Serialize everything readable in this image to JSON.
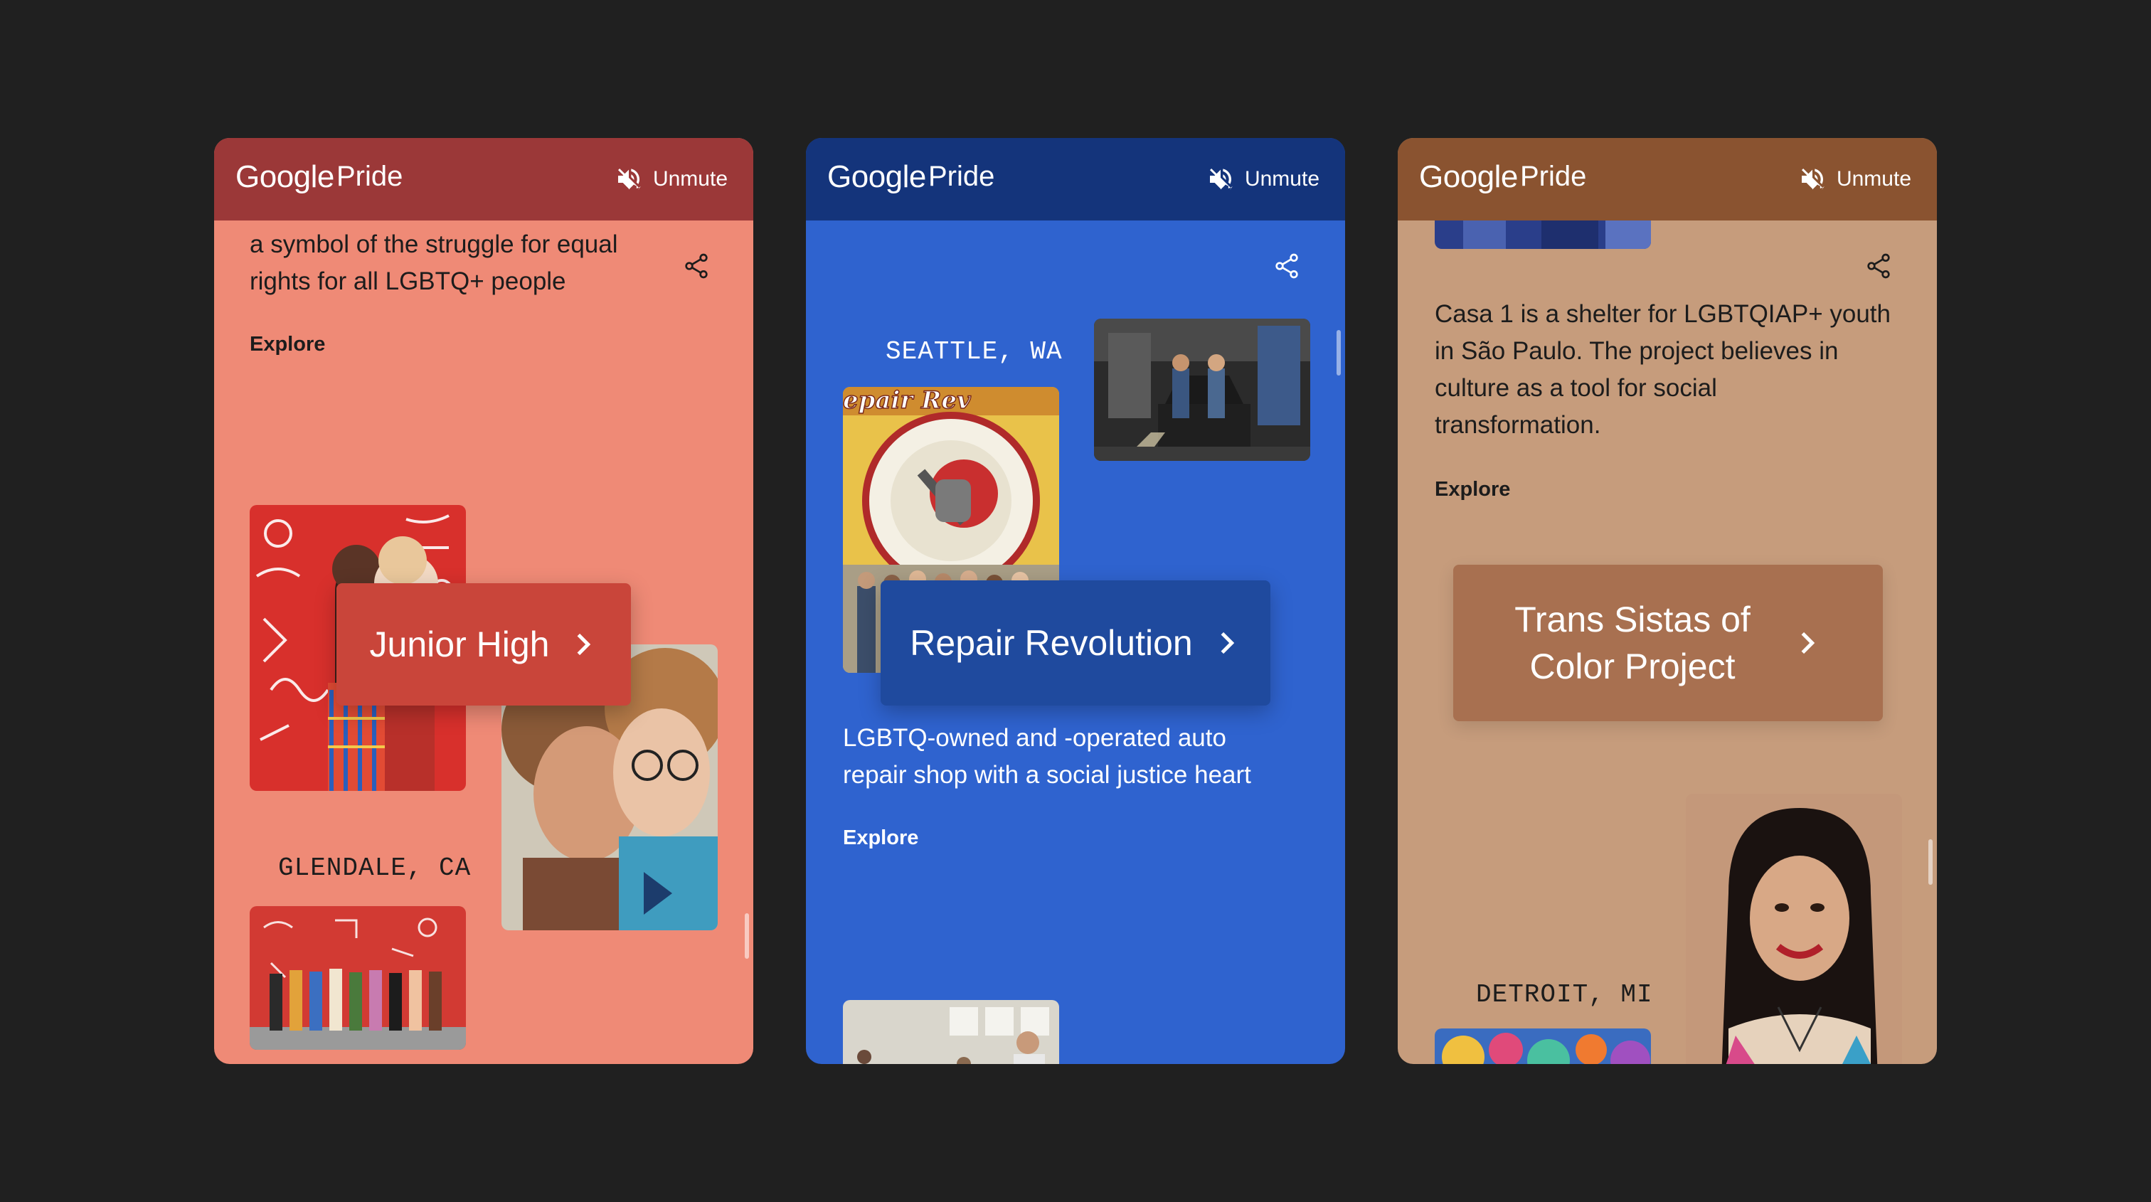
{
  "header": {
    "brand": "Google",
    "section": "Pride",
    "unmute_label": "Unmute"
  },
  "cards": [
    {
      "text": "a symbol of the struggle for equal rights for all LGBTQ+ people",
      "text_line1": "a symbol of the struggle for equal",
      "text_line2": "rights for all LGBTQ+ people",
      "explore": "Explore",
      "feature": "Junior High",
      "city": "GLENDALE, CA",
      "colors": {
        "bar": "#9b3838",
        "bg": "#ef8a76",
        "pill": "#c9453a"
      }
    },
    {
      "city": "SEATTLE, WA",
      "feature": "Repair Revolution",
      "text_line1": "LGBTQ-owned and -operated auto",
      "text_line2": "repair shop with a social justice heart",
      "explore": "Explore",
      "colors": {
        "bar": "#14347b",
        "bg": "#2f63cf",
        "pill": "#1f4a9e"
      }
    },
    {
      "text_line1": "Casa 1 is a shelter for LGBTQIAP+ youth",
      "text_line2": "in São Paulo. The project believes in",
      "text_line3": "culture as a tool for social",
      "text_line4": "transformation.",
      "explore": "Explore",
      "feature_line1": "Trans Sistas of",
      "feature_line2": "Color Project",
      "city": "DETROIT, MI",
      "colors": {
        "bar": "#8a5330",
        "bg": "#c69c7c",
        "pill": "#a87050"
      }
    }
  ]
}
